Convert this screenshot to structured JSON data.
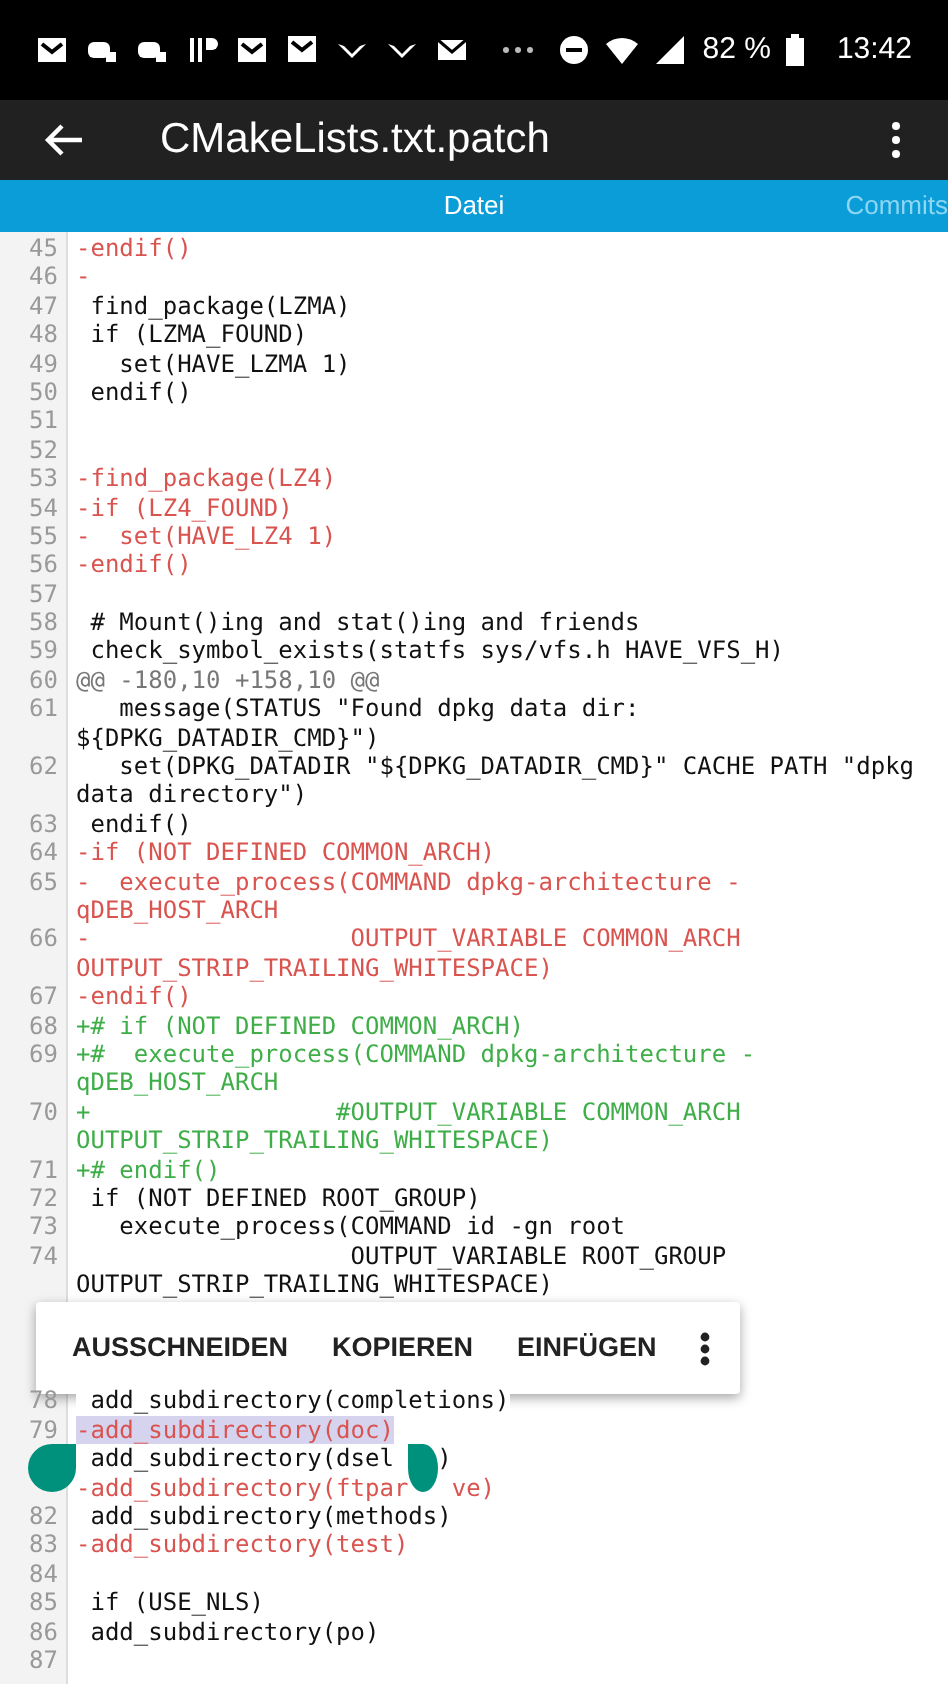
{
  "status_bar": {
    "battery": "82 %",
    "time": "13:42"
  },
  "toolbar": {
    "title": "CMakeLists.txt.patch"
  },
  "tabs": [
    {
      "label": "Datei",
      "selected": true
    },
    {
      "label": "Commits",
      "selected": false
    }
  ],
  "lines_top": [
    {
      "number": "45",
      "kind": "removed",
      "selected": false,
      "text": "-endif()"
    },
    {
      "number": "46",
      "kind": "removed",
      "selected": false,
      "text": "-"
    },
    {
      "number": "47",
      "kind": "context",
      "selected": false,
      "text": " find_package(LZMA)"
    },
    {
      "number": "48",
      "kind": "context",
      "selected": false,
      "text": " if (LZMA_FOUND)"
    },
    {
      "number": "49",
      "kind": "context",
      "selected": false,
      "text": "   set(HAVE_LZMA 1)"
    },
    {
      "number": "50",
      "kind": "context",
      "selected": false,
      "text": " endif()"
    },
    {
      "number": "51",
      "kind": "context",
      "selected": false
    },
    {
      "number": "52",
      "kind": "context",
      "selected": false
    },
    {
      "number": "53",
      "kind": "removed",
      "selected": false,
      "text": "-find_package(LZ4)"
    },
    {
      "number": "54",
      "kind": "removed",
      "selected": false,
      "text": "-if (LZ4_FOUND)"
    },
    {
      "number": "55",
      "kind": "removed",
      "selected": false,
      "text": "-  set(HAVE_LZ4 1)"
    },
    {
      "number": "56",
      "kind": "removed",
      "selected": false,
      "text": "-endif()"
    },
    {
      "number": "57",
      "kind": "context",
      "selected": false
    },
    {
      "number": "58",
      "kind": "context",
      "selected": false,
      "text": " # Mount()ing and stat()ing and friends"
    },
    {
      "number": "59",
      "kind": "context",
      "selected": false,
      "text": " check_symbol_exists(statfs sys/vfs.h HAVE_VFS_H)"
    },
    {
      "number": "60",
      "kind": "hunk",
      "selected": false,
      "text": "@@ -180,10 +158,10 @@"
    },
    {
      "number": "61",
      "kind": "context",
      "selected": false,
      "text": "   message(STATUS \"Found dpkg data dir:",
      "continuation": "${DPKG_DATADIR_CMD}\")"
    },
    {
      "number": "62",
      "kind": "context",
      "selected": false,
      "text": "   set(DPKG_DATADIR \"${DPKG_DATADIR_CMD}\" CACHE PATH \"dpkg",
      "continuation": "data directory\")"
    },
    {
      "number": "63",
      "kind": "context",
      "selected": false,
      "text": " endif()"
    },
    {
      "number": "64",
      "kind": "removed",
      "selected": false,
      "text": "-if (NOT DEFINED COMMON_ARCH)"
    },
    {
      "number": "65",
      "kind": "removed",
      "selected": false,
      "text": "-  execute_process(COMMAND dpkg-architecture -",
      "continuation": "qDEB_HOST_ARCH"
    },
    {
      "number": "66",
      "kind": "removed",
      "selected": false,
      "text": "-                  OUTPUT_VARIABLE COMMON_ARCH",
      "continuation": "OUTPUT_STRIP_TRAILING_WHITESPACE)"
    },
    {
      "number": "67",
      "kind": "removed",
      "selected": false,
      "text": "-endif()"
    },
    {
      "number": "68",
      "kind": "added",
      "selected": false,
      "text": "+# if (NOT DEFINED COMMON_ARCH)"
    },
    {
      "number": "69",
      "kind": "added",
      "selected": false,
      "text": "+#  execute_process(COMMAND dpkg-architecture -",
      "continuation": "qDEB_HOST_ARCH"
    },
    {
      "number": "70",
      "kind": "added",
      "selected": false,
      "text": "+                 #OUTPUT_VARIABLE COMMON_ARCH",
      "continuation": "OUTPUT_STRIP_TRAILING_WHITESPACE)"
    },
    {
      "number": "71",
      "kind": "added",
      "selected": false,
      "text": "+# endif()"
    },
    {
      "number": "72",
      "kind": "context",
      "selected": false,
      "text": " if (NOT DEFINED ROOT_GROUP)"
    },
    {
      "number": "73",
      "kind": "context",
      "selected": false,
      "text": "   execute_process(COMMAND id -gn root"
    },
    {
      "number": "74",
      "kind": "context",
      "selected": false,
      "text": "                   OUTPUT_VARIABLE ROOT_GROUP",
      "continuation": "OUTPUT_STRIP_TRAILING_WHITESPACE)"
    }
  ],
  "selection_menu": {
    "actions": [
      "AUSSCHNEIDEN",
      "KOPIEREN",
      "EINFÜGEN"
    ]
  },
  "lines_bottom": [
    {
      "number": "78",
      "kind": "context",
      "selected": false,
      "text": " add_subdirectory(completions)"
    },
    {
      "number": "79",
      "kind": "removed",
      "selected": true,
      "text": "-add_subdirectory(doc)"
    },
    {
      "kind": "context",
      "selected": false,
      "text": " add_subdirectory(dsel",
      "text_after_handle": ")"
    },
    {
      "kind": "removed",
      "selected": false,
      "text": "-add_subdirectory(ftpar",
      "text_after_handle": "ve)"
    },
    {
      "number": "82",
      "kind": "context",
      "selected": false,
      "text": " add_subdirectory(methods)"
    },
    {
      "number": "83",
      "kind": "removed",
      "selected": false,
      "text": "-add_subdirectory(test)"
    },
    {
      "number": "84",
      "kind": "context",
      "selected": false
    },
    {
      "number": "85",
      "kind": "context",
      "selected": false,
      "text": " if (USE_NLS)"
    },
    {
      "number": "86",
      "kind": "context",
      "selected": false,
      "text": " add_subdirectory(po)"
    },
    {
      "number": "87",
      "kind": "context",
      "selected": false
    }
  ]
}
